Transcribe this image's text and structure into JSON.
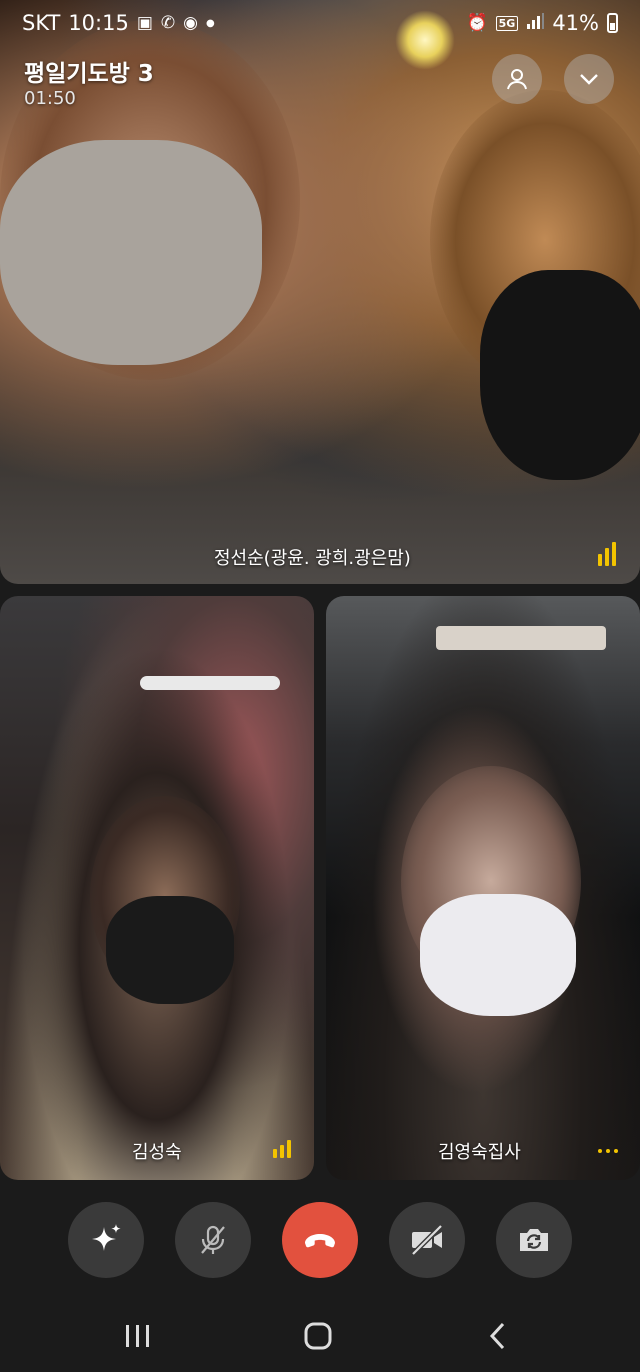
{
  "status_bar": {
    "carrier": "SKT",
    "time": "10:15",
    "network": "5G",
    "battery": "41%"
  },
  "call": {
    "room_title": "평일기도방 3",
    "timer": "01:50"
  },
  "participants": [
    {
      "name": "정선순(광윤. 광희.광은맘)",
      "indicator": "speaking-volume-icon"
    },
    {
      "name": "김성숙",
      "indicator": "speaking-volume-icon"
    },
    {
      "name": "김영숙집사",
      "indicator": "more-dots-icon"
    }
  ],
  "top_buttons": [
    "person-icon",
    "chevron-down-icon"
  ],
  "controls": [
    "effects-sparkle-icon",
    "mic-off-icon",
    "end-call-icon",
    "video-off-icon",
    "switch-camera-icon"
  ],
  "nav": [
    "recent-apps-icon",
    "home-icon",
    "back-icon"
  ],
  "colors": {
    "accent": "#f3c400",
    "end_call": "#e2513e",
    "background": "#1b1b1b"
  }
}
